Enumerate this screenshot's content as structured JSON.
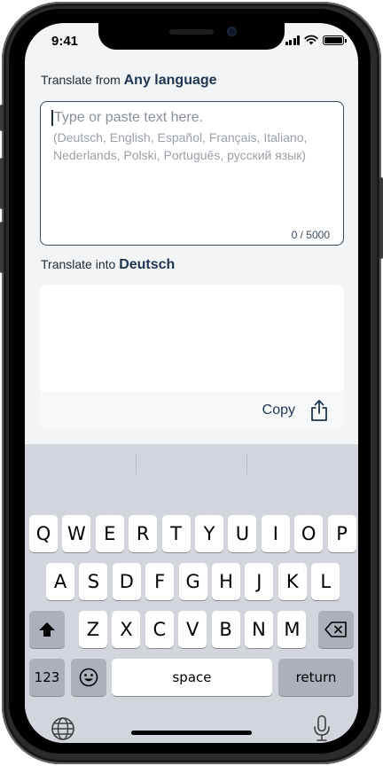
{
  "status": {
    "time": "9:41"
  },
  "source": {
    "label_prefix": "Translate from",
    "language": "Any language",
    "placeholder": "Type or paste text here.",
    "languages_hint": "(Deutsch, English, Español, Français, Italiano, Nederlands, Polski, Português, русский язык)",
    "char_count": "0 / 5000"
  },
  "target": {
    "label_prefix": "Translate into",
    "language": "Deutsch",
    "copy_label": "Copy"
  },
  "keyboard": {
    "row1": [
      "Q",
      "W",
      "E",
      "R",
      "T",
      "Y",
      "U",
      "I",
      "O",
      "P"
    ],
    "row2": [
      "A",
      "S",
      "D",
      "F",
      "G",
      "H",
      "J",
      "K",
      "L"
    ],
    "row3": [
      "Z",
      "X",
      "C",
      "V",
      "B",
      "N",
      "M"
    ],
    "numbers_label": "123",
    "space_label": "space",
    "return_label": "return"
  },
  "icons": {
    "shift": "shift-icon",
    "backspace": "backspace-icon",
    "emoji": "emoji-icon",
    "globe": "globe-icon",
    "mic": "microphone-icon",
    "share": "share-icon"
  }
}
